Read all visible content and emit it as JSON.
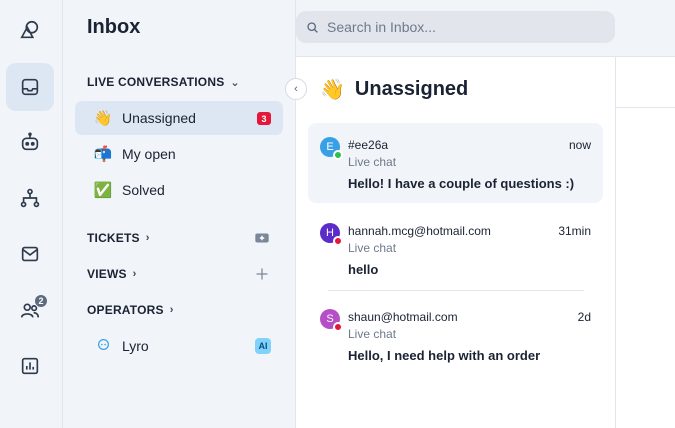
{
  "sidebar": {
    "title": "Inbox",
    "live_conversations": {
      "label": "LIVE CONVERSATIONS",
      "items": [
        {
          "emoji": "👋",
          "label": "Unassigned",
          "count": "3"
        },
        {
          "emoji": "📬",
          "label": "My open"
        },
        {
          "emoji": "✅",
          "label": "Solved"
        }
      ]
    },
    "tickets": {
      "label": "TICKETS"
    },
    "views": {
      "label": "VIEWS"
    },
    "operators": {
      "label": "OPERATORS",
      "items": [
        {
          "label": "Lyro",
          "badge": "AI"
        }
      ]
    }
  },
  "rail": {
    "operators_badge": "2"
  },
  "search": {
    "placeholder": "Search in Inbox..."
  },
  "list": {
    "emoji": "👋",
    "title": "Unassigned",
    "conversations": [
      {
        "initial": "E",
        "name": "#ee26a",
        "time": "now",
        "channel": "Live chat",
        "message": "Hello! I have a couple of questions :)",
        "avatar_color": "#3aa0e6",
        "status_color": "#2fbf4f"
      },
      {
        "initial": "H",
        "name": "hannah.mcg@hotmail.com",
        "time": "31min",
        "channel": "Live chat",
        "message": "hello",
        "avatar_color": "#5b2cc9",
        "status_color": "#e4163a"
      },
      {
        "initial": "S",
        "name": "shaun@hotmail.com",
        "time": "2d",
        "channel": "Live chat",
        "message": "Hello, I need help with an order",
        "avatar_color": "#b44fc7",
        "status_color": "#e4163a"
      }
    ]
  },
  "colors": {
    "accent_bg": "#dde6f3",
    "panel_bg": "#f1f4f8",
    "badge_red": "#e4163a"
  }
}
